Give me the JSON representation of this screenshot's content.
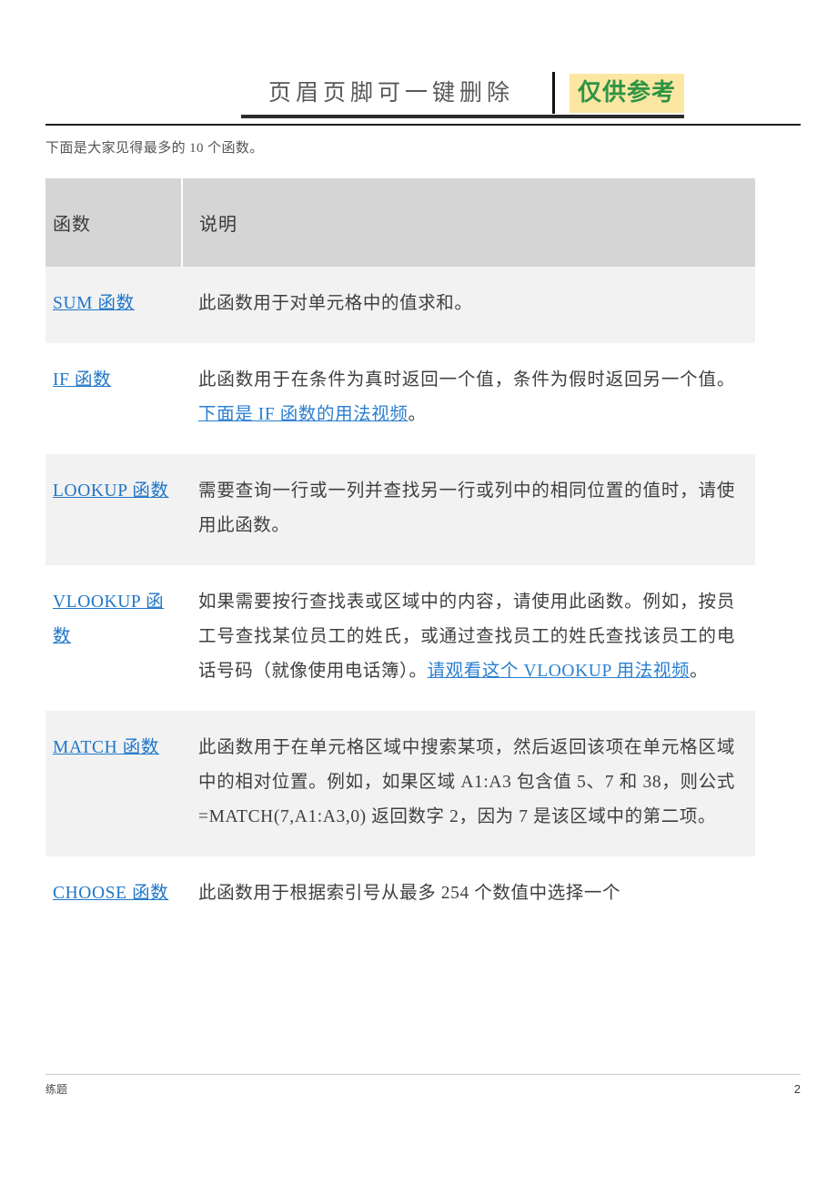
{
  "header": {
    "title": "页眉页脚可一键删除",
    "badge": "仅供参考",
    "badge_bg": "#fbe6a2",
    "badge_color": "#2e9443"
  },
  "intro": "下面是大家见得最多的 10 个函数。",
  "table": {
    "columns": [
      "函数",
      "说明"
    ],
    "rows": [
      {
        "name": "SUM 函数",
        "desc_parts": [
          {
            "type": "text",
            "value": "此函数用于对单元格中的值求和。"
          }
        ]
      },
      {
        "name": "IF 函数",
        "desc_parts": [
          {
            "type": "text",
            "value": "此函数用于在条件为真时返回一个值，条件为假时返回另一个值。 "
          },
          {
            "type": "link",
            "value": "下面是 IF 函数的用法视频"
          },
          {
            "type": "text",
            "value": "。"
          }
        ]
      },
      {
        "name": "LOOKUP 函数",
        "desc_parts": [
          {
            "type": "text",
            "value": "需要查询一行或一列并查找另一行或列中的相同位置的值时，请使用此函数。"
          }
        ]
      },
      {
        "name": "VLOOKUP 函数",
        "desc_parts": [
          {
            "type": "text",
            "value": "如果需要按行查找表或区域中的内容，请使用此函数。例如，按员工号查找某位员工的姓氏，或通过查找员工的姓氏查找该员工的电话号码（就像使用电话簿）。"
          },
          {
            "type": "link",
            "value": "请观看这个 VLOOKUP 用法视频"
          },
          {
            "type": "text",
            "value": "。"
          }
        ]
      },
      {
        "name": "MATCH 函数",
        "desc_parts": [
          {
            "type": "text",
            "value": "此函数用于在单元格区域中搜索某项，然后返回该项在单元格区域中的相对位置。例如，如果区域 A1:A3 包含值 5、7 和 38，则公式 =MATCH(7,A1:A3,0) 返回数字 2，因为 7 是该区域中的第二项。"
          }
        ]
      },
      {
        "name": "CHOOSE 函数",
        "desc_parts": [
          {
            "type": "text",
            "value": "此函数用于根据索引号从最多 254 个数值中选择一个"
          }
        ]
      }
    ]
  },
  "footer": {
    "left": "练题",
    "page_number": "2"
  },
  "colors": {
    "link": "#1f76c8",
    "header_row_bg": "#d5d5d5",
    "shaded_row_bg": "#f2f2f2"
  }
}
